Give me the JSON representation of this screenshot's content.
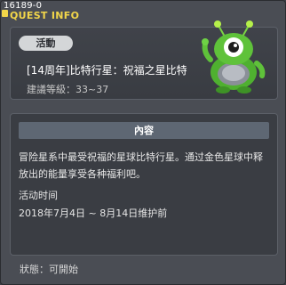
{
  "window": {
    "id_label": "16189-0",
    "title": "QUEST INFO"
  },
  "quest": {
    "category_tag": "活動",
    "name": "[14周年]比特行星：祝福之星比特",
    "level_requirement": "建議等級：33~37"
  },
  "content": {
    "header": "內容",
    "description": "冒险星系中最受祝福的星球比特行星。通过金色星球中释放出的能量享受各种福利吧。",
    "time_label": "活动时间",
    "time_value": "2018年7月4日 ~ 8月14日维护前"
  },
  "status": "狀態：可開始",
  "colors": {
    "title": "#f2d64a",
    "mascot_green": "#5fc23a",
    "tag_bg": "#d4d6d8",
    "header_bg": "#5e6773"
  },
  "icons": {
    "quest": "quest-icon",
    "mascot": "alien-mascot-icon"
  }
}
